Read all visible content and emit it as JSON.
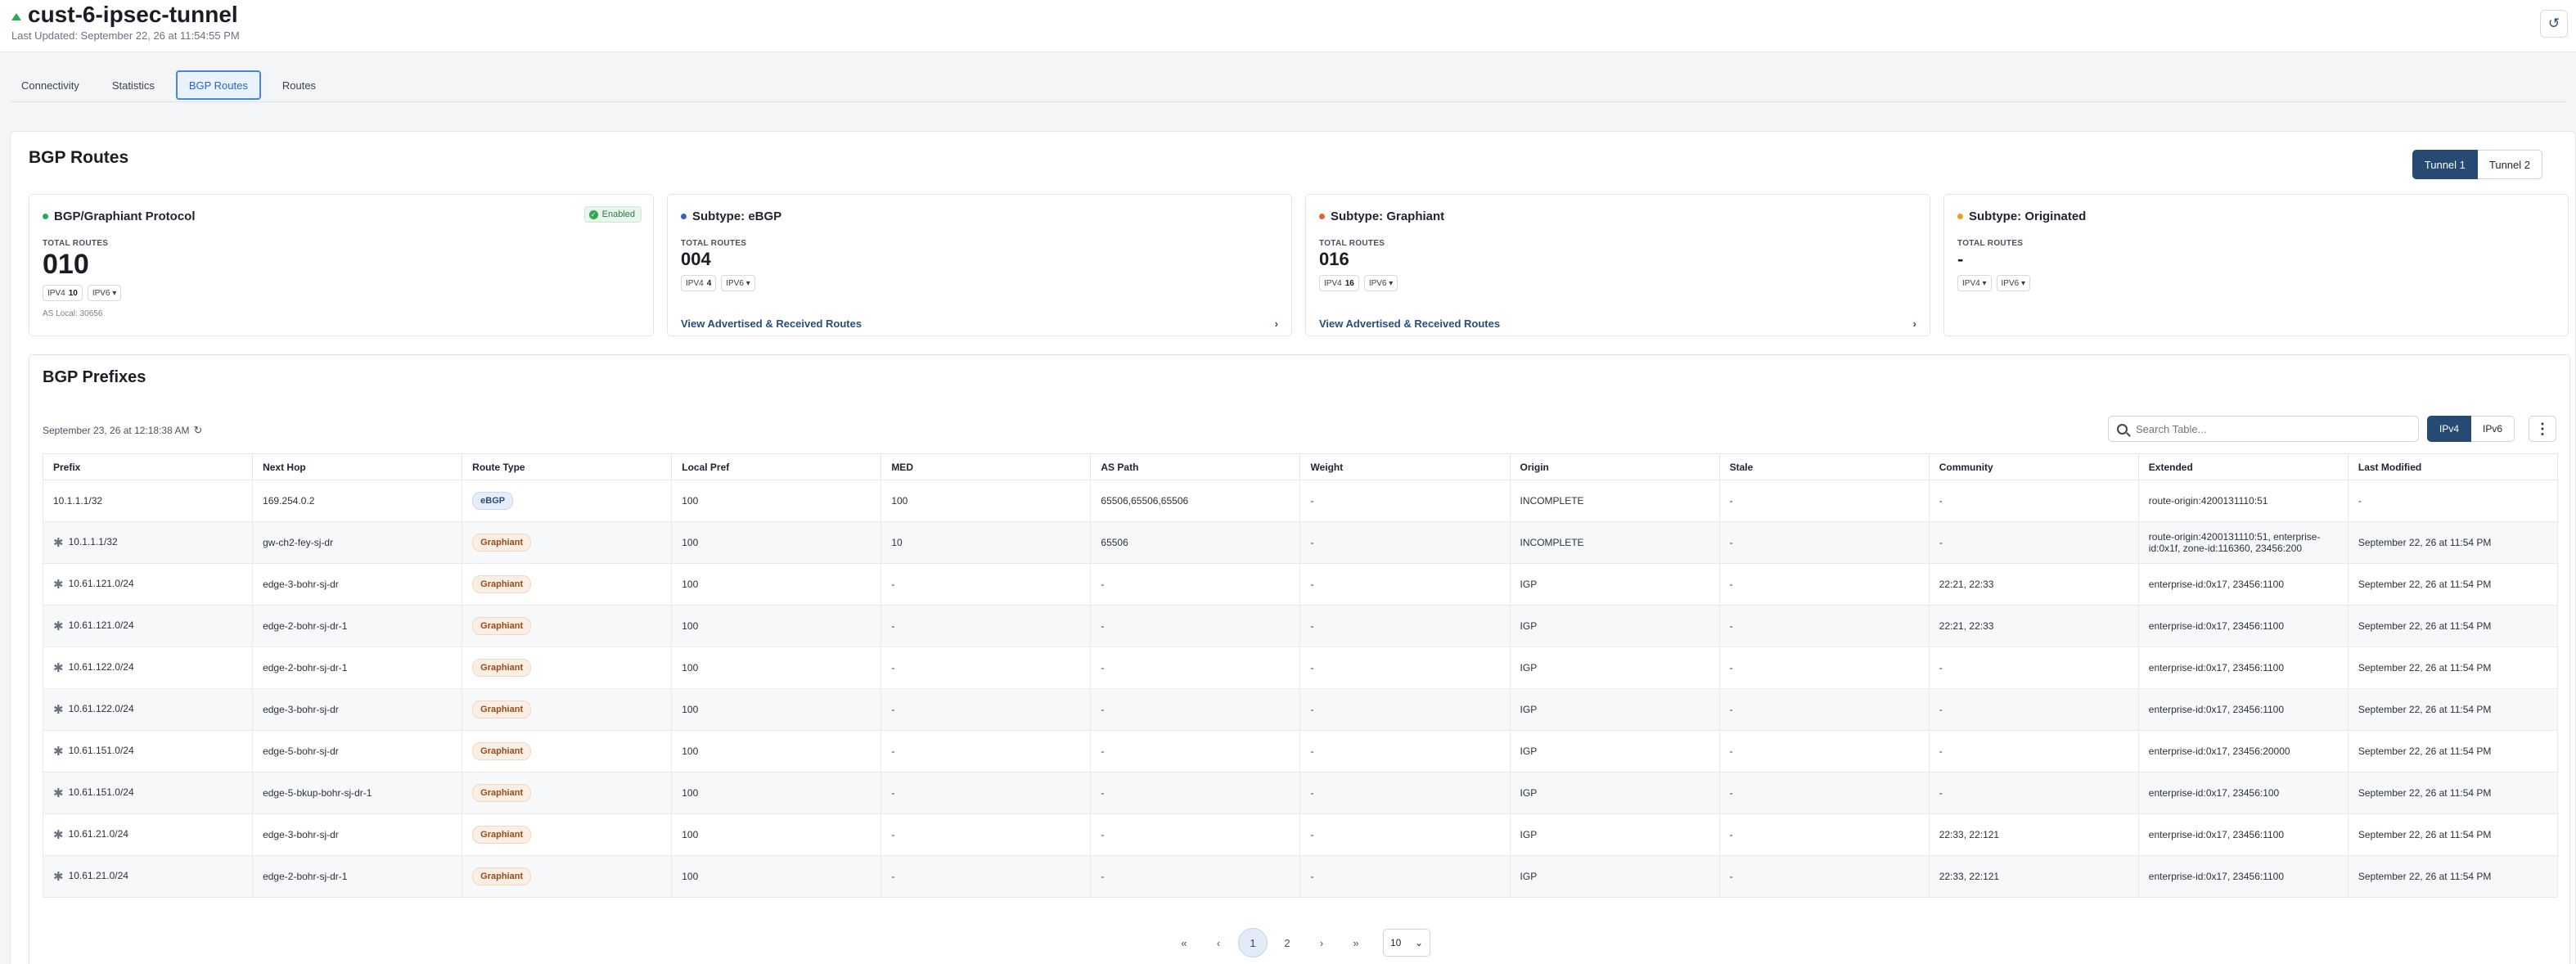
{
  "header": {
    "title": "cust-6-ipsec-tunnel",
    "last_updated": "Last Updated: September 22, 26 at 11:54:55 PM",
    "refresh_icon": "refresh-icon"
  },
  "tabs": [
    {
      "label": "Connectivity",
      "active": false
    },
    {
      "label": "Statistics",
      "active": false
    },
    {
      "label": "BGP Routes",
      "active": true
    },
    {
      "label": "Routes",
      "active": false
    }
  ],
  "bgp_routes": {
    "title": "BGP Routes",
    "tunnels": [
      "Tunnel 1",
      "Tunnel 2"
    ],
    "active_tunnel": "Tunnel 1"
  },
  "cards": [
    {
      "name": "BGP/Graphiant Protocol",
      "dot_color": "#2fa84f",
      "badge": "Enabled",
      "total_label": "TOTAL ROUTES",
      "total": "010",
      "ipv4_label": "IPV4",
      "ipv4": "10",
      "ipv6_label": "IPV6",
      "as_local": "AS Local: 30656"
    },
    {
      "name": "Subtype: eBGP",
      "dot_color": "#3b63b8",
      "total_label": "TOTAL ROUTES",
      "total": "004",
      "ipv4_label": "IPV4",
      "ipv4": "4",
      "ipv6_label": "IPV6",
      "link": "View Advertised & Received Routes"
    },
    {
      "name": "Subtype: Graphiant",
      "dot_color": "#e0662a",
      "total_label": "TOTAL ROUTES",
      "total": "016",
      "ipv4_label": "IPV4",
      "ipv4": "16",
      "ipv6_label": "IPV6",
      "link": "View Advertised & Received Routes"
    },
    {
      "name": "Subtype: Originated",
      "dot_color": "#e3a321",
      "total_label": "TOTAL ROUTES",
      "total": "-",
      "ipv4_label": "IPV4",
      "ipv6_label": "IPV6"
    }
  ],
  "prefixes": {
    "title": "BGP Prefixes",
    "timestamp": "September 23, 26 at 12:18:38 AM",
    "search_placeholder": "Search Table...",
    "ip_toggle": [
      "IPv4",
      "IPv6"
    ],
    "active_ip": "IPv4",
    "columns": [
      "Prefix",
      "Next Hop",
      "Route Type",
      "Local Pref",
      "MED",
      "AS Path",
      "Weight",
      "Origin",
      "Stale",
      "Community",
      "Extended",
      "Last Modified"
    ],
    "rows": [
      {
        "star": false,
        "prefix": "10.1.1.1/32",
        "next_hop": "169.254.0.2",
        "route_type": "eBGP",
        "local_pref": "100",
        "med": "100",
        "as_path": "65506,65506,65506",
        "weight": "-",
        "origin": "INCOMPLETE",
        "stale": "-",
        "community": "-",
        "extended": "route-origin:4200131110:51",
        "last_modified": "-"
      },
      {
        "star": true,
        "prefix": "10.1.1.1/32",
        "next_hop": "gw-ch2-fey-sj-dr",
        "route_type": "Graphiant",
        "local_pref": "100",
        "med": "10",
        "as_path": "65506",
        "weight": "-",
        "origin": "INCOMPLETE",
        "stale": "-",
        "community": "-",
        "extended": "route-origin:4200131110:51, enterprise-id:0x1f, zone-id:116360, 23456:200",
        "last_modified": "September 22, 26 at 11:54 PM"
      },
      {
        "star": true,
        "prefix": "10.61.121.0/24",
        "next_hop": "edge-3-bohr-sj-dr",
        "route_type": "Graphiant",
        "local_pref": "100",
        "med": "-",
        "as_path": "-",
        "weight": "-",
        "origin": "IGP",
        "stale": "-",
        "community": "22:21, 22:33",
        "extended": "enterprise-id:0x17, 23456:1100",
        "last_modified": "September 22, 26 at 11:54 PM"
      },
      {
        "star": true,
        "prefix": "10.61.121.0/24",
        "next_hop": "edge-2-bohr-sj-dr-1",
        "route_type": "Graphiant",
        "local_pref": "100",
        "med": "-",
        "as_path": "-",
        "weight": "-",
        "origin": "IGP",
        "stale": "-",
        "community": "22:21, 22:33",
        "extended": "enterprise-id:0x17, 23456:1100",
        "last_modified": "September 22, 26 at 11:54 PM"
      },
      {
        "star": true,
        "prefix": "10.61.122.0/24",
        "next_hop": "edge-2-bohr-sj-dr-1",
        "route_type": "Graphiant",
        "local_pref": "100",
        "med": "-",
        "as_path": "-",
        "weight": "-",
        "origin": "IGP",
        "stale": "-",
        "community": "-",
        "extended": "enterprise-id:0x17, 23456:1100",
        "last_modified": "September 22, 26 at 11:54 PM"
      },
      {
        "star": true,
        "prefix": "10.61.122.0/24",
        "next_hop": "edge-3-bohr-sj-dr",
        "route_type": "Graphiant",
        "local_pref": "100",
        "med": "-",
        "as_path": "-",
        "weight": "-",
        "origin": "IGP",
        "stale": "-",
        "community": "-",
        "extended": "enterprise-id:0x17, 23456:1100",
        "last_modified": "September 22, 26 at 11:54 PM"
      },
      {
        "star": true,
        "prefix": "10.61.151.0/24",
        "next_hop": "edge-5-bohr-sj-dr",
        "route_type": "Graphiant",
        "local_pref": "100",
        "med": "-",
        "as_path": "-",
        "weight": "-",
        "origin": "IGP",
        "stale": "-",
        "community": "-",
        "extended": "enterprise-id:0x17, 23456:20000",
        "last_modified": "September 22, 26 at 11:54 PM"
      },
      {
        "star": true,
        "prefix": "10.61.151.0/24",
        "next_hop": "edge-5-bkup-bohr-sj-dr-1",
        "route_type": "Graphiant",
        "local_pref": "100",
        "med": "-",
        "as_path": "-",
        "weight": "-",
        "origin": "IGP",
        "stale": "-",
        "community": "-",
        "extended": "enterprise-id:0x17, 23456:100",
        "last_modified": "September 22, 26 at 11:54 PM"
      },
      {
        "star": true,
        "prefix": "10.61.21.0/24",
        "next_hop": "edge-3-bohr-sj-dr",
        "route_type": "Graphiant",
        "local_pref": "100",
        "med": "-",
        "as_path": "-",
        "weight": "-",
        "origin": "IGP",
        "stale": "-",
        "community": "22:33, 22:121",
        "extended": "enterprise-id:0x17, 23456:1100",
        "last_modified": "September 22, 26 at 11:54 PM"
      },
      {
        "star": true,
        "prefix": "10.61.21.0/24",
        "next_hop": "edge-2-bohr-sj-dr-1",
        "route_type": "Graphiant",
        "local_pref": "100",
        "med": "-",
        "as_path": "-",
        "weight": "-",
        "origin": "IGP",
        "stale": "-",
        "community": "22:33, 22:121",
        "extended": "enterprise-id:0x17, 23456:1100",
        "last_modified": "September 22, 26 at 11:54 PM"
      }
    ],
    "pagination": {
      "first": "«",
      "prev": "‹",
      "pages": [
        "1",
        "2"
      ],
      "current": "1",
      "next": "›",
      "last": "»",
      "per_page": "10"
    }
  }
}
